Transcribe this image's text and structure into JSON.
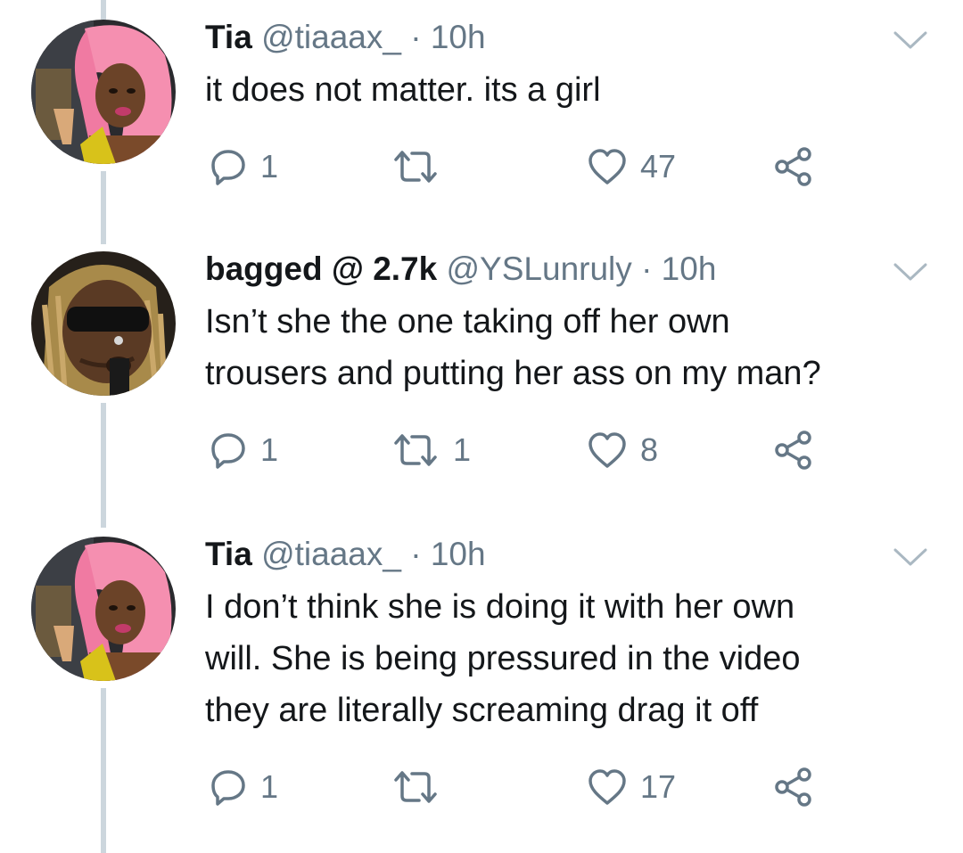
{
  "tweets": [
    {
      "name": "Tia",
      "handle": "@tiaaax_",
      "dot": "·",
      "time": "10h",
      "lines": [
        "it does not matter. its a girl"
      ],
      "replies": "1",
      "retweets": "",
      "likes": "47",
      "avatar": "pink-hair-woman"
    },
    {
      "name": "bagged @ 2.7k",
      "handle": "@YSLunruly",
      "dot": "·",
      "time": "10h",
      "lines": [
        "Isn’t she the one taking off her own",
        "trousers and putting her ass on my man?"
      ],
      "replies": "1",
      "retweets": "1",
      "likes": "8",
      "avatar": "man-with-sunglasses"
    },
    {
      "name": "Tia",
      "handle": "@tiaaax_",
      "dot": "·",
      "time": "10h",
      "lines": [
        "I don’t think she is doing it with her own",
        "will. She is being pressured in the video",
        "they are literally screaming drag it off"
      ],
      "replies": "1",
      "retweets": "",
      "likes": "17",
      "avatar": "pink-hair-woman"
    }
  ],
  "colors": {
    "text": "#14171a",
    "muted": "#657786",
    "thread": "#ccd6dd",
    "icon": "#657786"
  },
  "icons": [
    "reply-icon",
    "retweet-icon",
    "like-icon",
    "share-icon",
    "chevron-down-icon"
  ]
}
